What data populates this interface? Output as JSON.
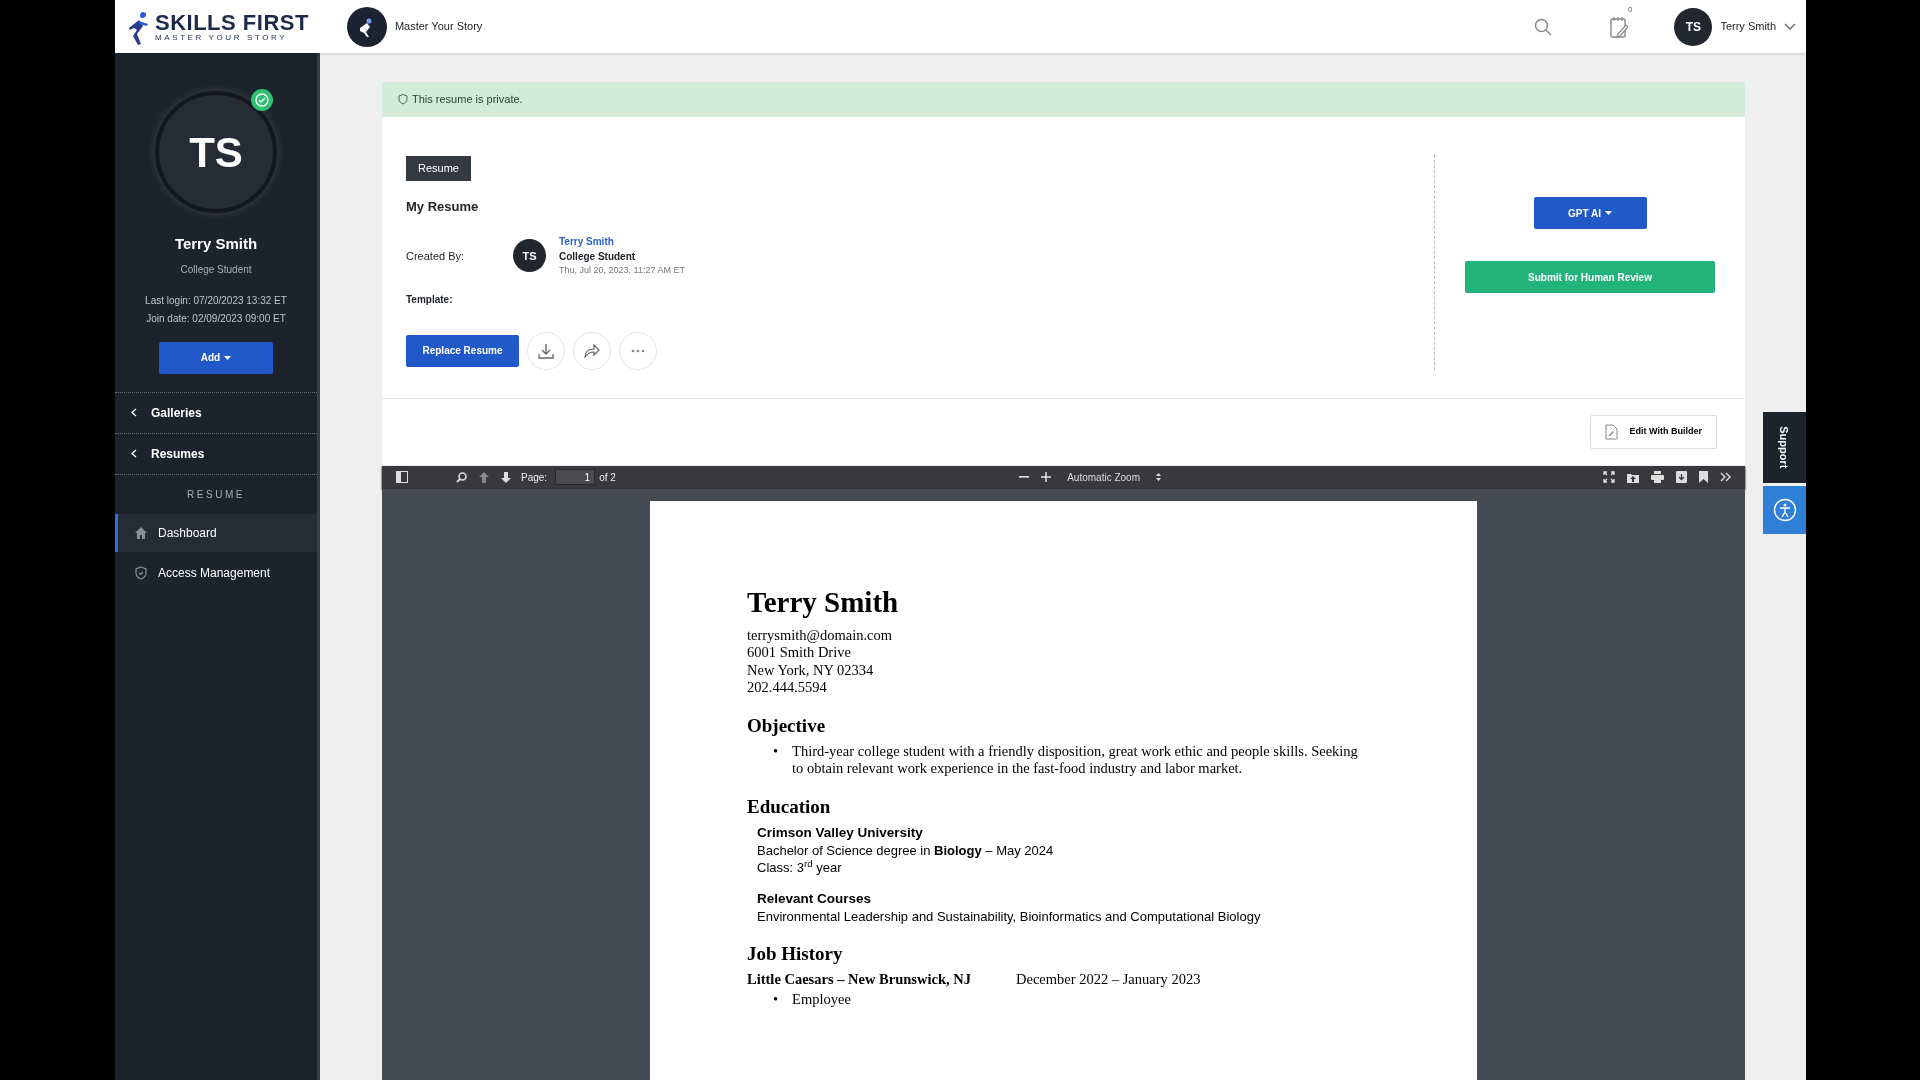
{
  "topbar": {
    "brand": "SKILLS FIRST",
    "tagline": "MASTER YOUR STORY",
    "org": "Master Your Story",
    "notification_count": "0",
    "user_initials": "TS",
    "user_name": "Terry Smith"
  },
  "sidebar": {
    "initials": "TS",
    "verified": true,
    "name": "Terry Smith",
    "role": "College Student",
    "last_login": "Last login: 07/20/2023 13:32 ET",
    "join_date": "Join date: 02/09/2023 09:00 ET",
    "add_button": "Add",
    "groups": [
      {
        "label": "Galleries",
        "expanded": false
      },
      {
        "label": "Resumes",
        "expanded": false
      }
    ],
    "section_title": "RESUME",
    "items": [
      {
        "label": "Dashboard",
        "kind": "home",
        "selected": true
      },
      {
        "label": "Access Management",
        "kind": "shield",
        "selected": false
      }
    ]
  },
  "banner": "This resume is private.",
  "resume": {
    "tag": "Resume",
    "title": "My Resume",
    "created_by_label": "Created By:",
    "creator": {
      "initials": "TS",
      "name": "Terry Smith",
      "role": "College Student",
      "date": "Thu, Jul 20, 2023, 11:27 AM ET"
    },
    "template_label": "Template:",
    "replace_button": "Replace Resume",
    "gpt_button": "GPT AI",
    "review_button": "Submit for Human Review",
    "edit_button": "Edit With Builder"
  },
  "viewer": {
    "page_label": "Page:",
    "page": "1",
    "page_total": "of 2",
    "zoom": "Automatic Zoom"
  },
  "document": [
    {
      "kind": "name",
      "text": "Terry Smith"
    },
    {
      "kind": "contact",
      "lines": [
        "terrysmith@domain.com",
        "6001 Smith Drive",
        "New York, NY 02334",
        "202.444.5594"
      ]
    },
    {
      "kind": "heading",
      "text": "Objective"
    },
    {
      "kind": "bullets",
      "marker": "•",
      "items": [
        "Third-year college student with a friendly disposition, great work ethic and people skills. Seeking to obtain relevant work experience in the fast-food industry and labor market."
      ]
    },
    {
      "kind": "heading",
      "text": "Education"
    },
    {
      "kind": "subheading",
      "text": "Crimson Valley University"
    },
    {
      "kind": "line",
      "text": "Bachelor of Science degree in **Biology** – May 2024"
    },
    {
      "kind": "line",
      "text": "Class: 3$^{rd}$ year"
    },
    {
      "kind": "subheading",
      "text": "Relevant Courses"
    },
    {
      "kind": "line",
      "text": "Environmental Leadership and Sustainability, Bioinformatics and Computational Biology"
    },
    {
      "kind": "heading",
      "text": "Job History"
    },
    {
      "kind": "job",
      "title": "Little Caesars – New Brunswick, NJ",
      "dates": "December 2022 – January 2023"
    },
    {
      "kind": "bullets",
      "marker": "•",
      "items": [
        "Employee"
      ]
    }
  ],
  "support": "Support"
}
